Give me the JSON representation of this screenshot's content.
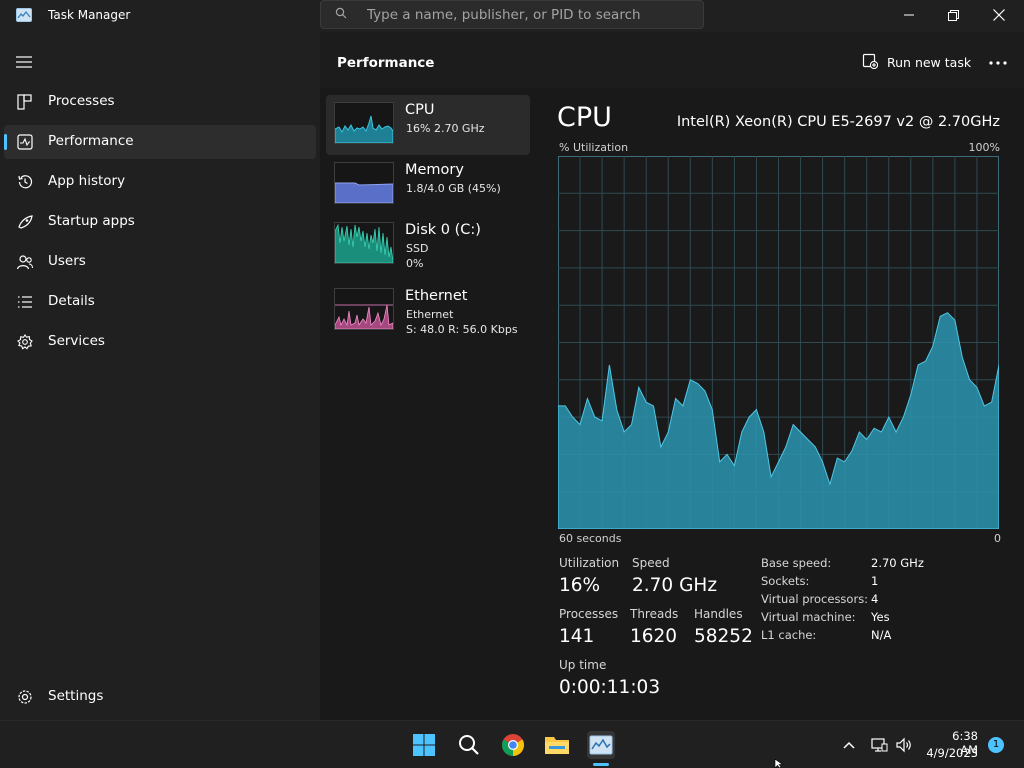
{
  "window": {
    "title": "Task Manager",
    "search_placeholder": "Type a name, publisher, or PID to search"
  },
  "nav": {
    "items": [
      {
        "label": "Processes",
        "icon": "processes-icon"
      },
      {
        "label": "Performance",
        "icon": "performance-icon",
        "active": true
      },
      {
        "label": "App history",
        "icon": "history-icon"
      },
      {
        "label": "Startup apps",
        "icon": "startup-icon"
      },
      {
        "label": "Users",
        "icon": "users-icon"
      },
      {
        "label": "Details",
        "icon": "details-icon"
      },
      {
        "label": "Services",
        "icon": "services-icon"
      }
    ],
    "settings_label": "Settings"
  },
  "content": {
    "title": "Performance",
    "run_new_task_label": "Run new task"
  },
  "perf_list": {
    "cpu": {
      "title": "CPU",
      "sub1": "16%  2.70 GHz"
    },
    "memory": {
      "title": "Memory",
      "sub1": "1.8/4.0 GB (45%)"
    },
    "disk": {
      "title": "Disk 0 (C:)",
      "sub1": "SSD",
      "sub2": "0%"
    },
    "ethernet": {
      "title": "Ethernet",
      "sub1": "Ethernet",
      "sub2": "S: 48.0  R: 56.0 Kbps"
    }
  },
  "cpu_detail": {
    "title": "CPU",
    "model": "Intel(R) Xeon(R) CPU E5-2697 v2 @ 2.70GHz",
    "y_axis_label": "% Utilization",
    "y_axis_max": "100%",
    "x_axis_left": "60 seconds",
    "x_axis_right": "0",
    "stats": {
      "utilization_label": "Utilization",
      "utilization_value": "16%",
      "speed_label": "Speed",
      "speed_value": "2.70 GHz",
      "processes_label": "Processes",
      "processes_value": "141",
      "threads_label": "Threads",
      "threads_value": "1620",
      "handles_label": "Handles",
      "handles_value": "58252",
      "uptime_label": "Up time",
      "uptime_value": "0:00:11:03"
    },
    "specs": [
      {
        "label": "Base speed:",
        "value": "2.70 GHz"
      },
      {
        "label": "Sockets:",
        "value": "1"
      },
      {
        "label": "Virtual processors:",
        "value": "4"
      },
      {
        "label": "Virtual machine:",
        "value": "Yes"
      },
      {
        "label": "L1 cache:",
        "value": "N/A"
      }
    ]
  },
  "chart_data": {
    "type": "area",
    "ylim": [
      0,
      100
    ],
    "series": [
      {
        "values": [
          33,
          33,
          30,
          28,
          35,
          30,
          29,
          44,
          32,
          26,
          28,
          38,
          34,
          33,
          22,
          26,
          35,
          33,
          40,
          39,
          37,
          32,
          18,
          20,
          17,
          26,
          30,
          32,
          26,
          14,
          18,
          22,
          28,
          26,
          24,
          22,
          18,
          12,
          19,
          18,
          21,
          26,
          24,
          27,
          26,
          30,
          26,
          30,
          36,
          44,
          45,
          49,
          57,
          58,
          56,
          46,
          40,
          38,
          33,
          34,
          44
        ]
      }
    ],
    "color": "#3ba6c4",
    "grid": true
  },
  "taskbar": {
    "apps": [
      "start-icon",
      "search-icon",
      "chrome-icon",
      "file-explorer-icon",
      "task-manager-icon"
    ],
    "time": "6:38 AM",
    "date": "4/9/2023",
    "notification_count": "1"
  }
}
